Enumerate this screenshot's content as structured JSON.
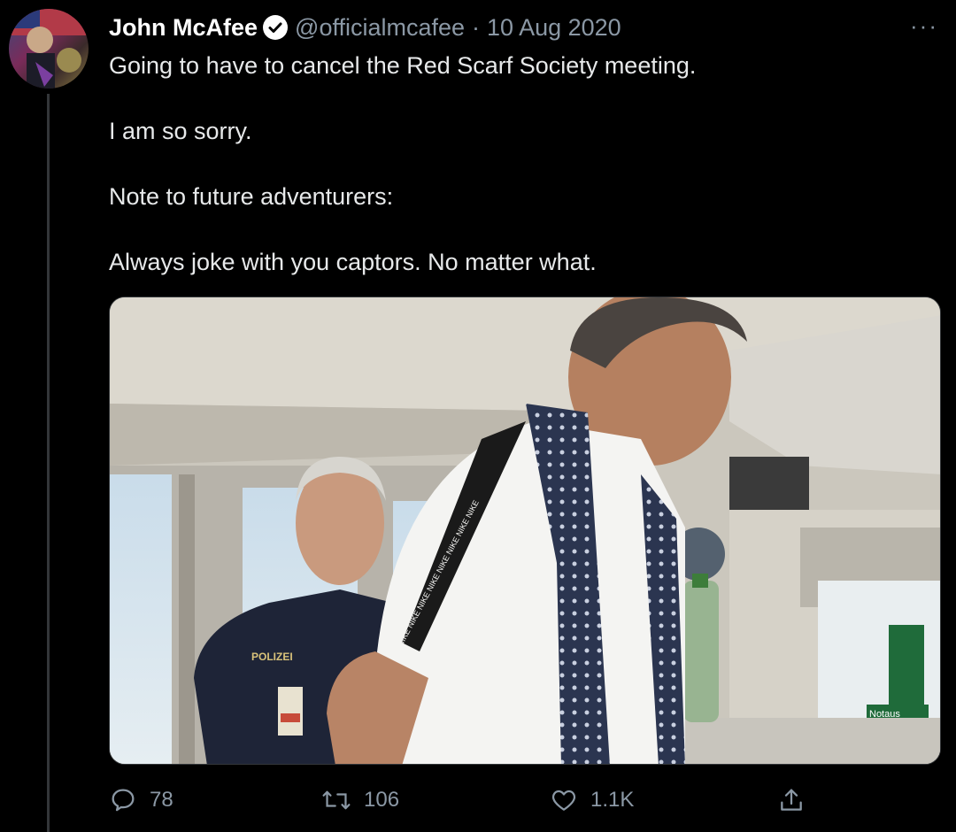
{
  "tweet": {
    "author_name": "John McAfee",
    "handle": "@officialmcafee",
    "separator": "·",
    "date": "10 Aug 2020",
    "more_label": "···",
    "text_lines": [
      "Going to have to cancel the Red Scarf Society meeting.",
      "I am so sorry.",
      "Note to future adventurers:",
      "Always joke with you captors. No matter what."
    ],
    "photo_text": {
      "uniform_label": "POLIZEI",
      "shirt_print": "NIKE NIKE NIKE NIKE NIKE NIKE NIKE NIKE",
      "sign_text": "Notaus"
    }
  },
  "actions": {
    "reply_count": "78",
    "retweet_count": "106",
    "like_count": "1.1K"
  },
  "icons": {
    "verified": "verified-badge-icon",
    "reply": "speech-bubble-icon",
    "retweet": "retweet-arrows-icon",
    "like": "heart-icon",
    "share": "share-upload-icon"
  },
  "colors": {
    "background": "#000000",
    "text": "#e7e9ea",
    "muted": "#8b98a5",
    "divider": "#333639"
  }
}
